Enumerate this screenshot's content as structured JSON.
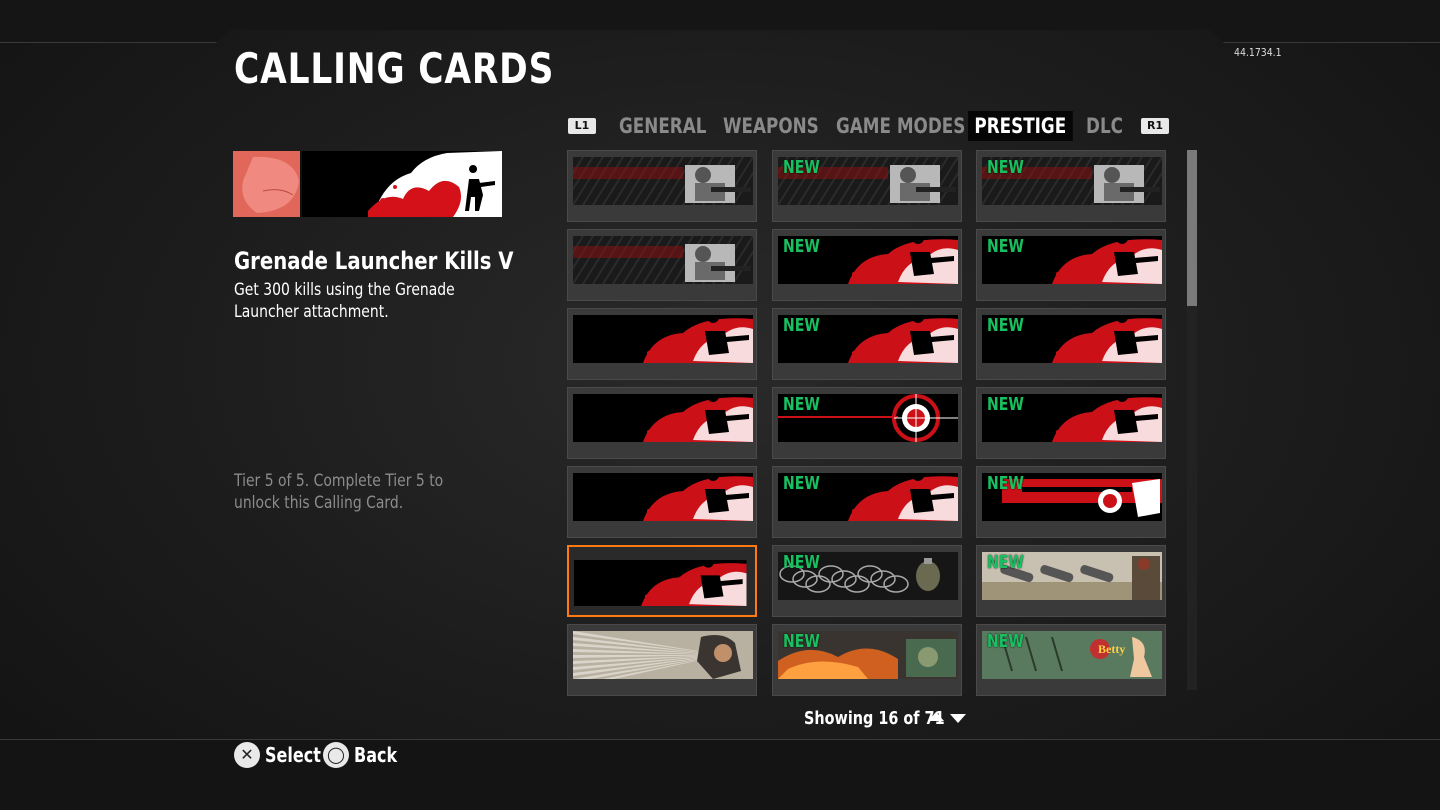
{
  "page": {
    "title": "CALLING CARDS",
    "version": "44.1734.1"
  },
  "tabs": {
    "left_bumper": "L1",
    "right_bumper": "R1",
    "items": [
      "GENERAL",
      "WEAPONS",
      "GAME MODES",
      "PRESTIGE",
      "DLC"
    ],
    "active": "PRESTIGE"
  },
  "selected_card": {
    "name": "Grenade Launcher Kills V",
    "description": "Get 300 kills using the Grenade Launcher attachment.",
    "status": "Tier 5 of 5. Complete Tier 5 to unlock this Calling Card."
  },
  "grid": {
    "new_label": "NEW",
    "selected_index": 15,
    "cards": [
      {
        "new": false,
        "art": "soldier-gasmask-red-carbon"
      },
      {
        "new": true,
        "art": "soldier-carbon-dark"
      },
      {
        "new": true,
        "art": "soldier-sniper-carbon"
      },
      {
        "new": false,
        "art": "soldier-helmet-carbon"
      },
      {
        "new": true,
        "art": "red-splatter-soldier"
      },
      {
        "new": true,
        "art": "red-bullet-streak"
      },
      {
        "new": false,
        "art": "red-white-splatter-gunner"
      },
      {
        "new": true,
        "art": "red-fighter-punch"
      },
      {
        "new": true,
        "art": "red-white-leaping-gunner"
      },
      {
        "new": false,
        "art": "red-muzzle-flash-gunner"
      },
      {
        "new": true,
        "art": "red-crosshair-target"
      },
      {
        "new": true,
        "art": "red-soldier-silhouette"
      },
      {
        "new": false,
        "art": "red-white-pistol-aim"
      },
      {
        "new": true,
        "art": "red-flash-crouch"
      },
      {
        "new": true,
        "art": "red-sniper-scope"
      },
      {
        "new": false,
        "art": "grenade-launcher-splash"
      },
      {
        "new": true,
        "art": "grenade-wire-pile"
      },
      {
        "new": true,
        "art": "mortar-shells-sepia"
      },
      {
        "new": false,
        "art": "burst-headset-soldier"
      },
      {
        "new": true,
        "art": "fiery-battlefield"
      },
      {
        "new": true,
        "art": "betty-pinup-green"
      }
    ]
  },
  "pagination": {
    "showing": "Showing 16 of 71"
  },
  "prompts": [
    {
      "button": "✕",
      "label": "Select"
    },
    {
      "button": "◯",
      "label": "Back"
    }
  ],
  "colors": {
    "accent": "#ff7a12",
    "new": "#18c060",
    "red": "#cc1018"
  }
}
